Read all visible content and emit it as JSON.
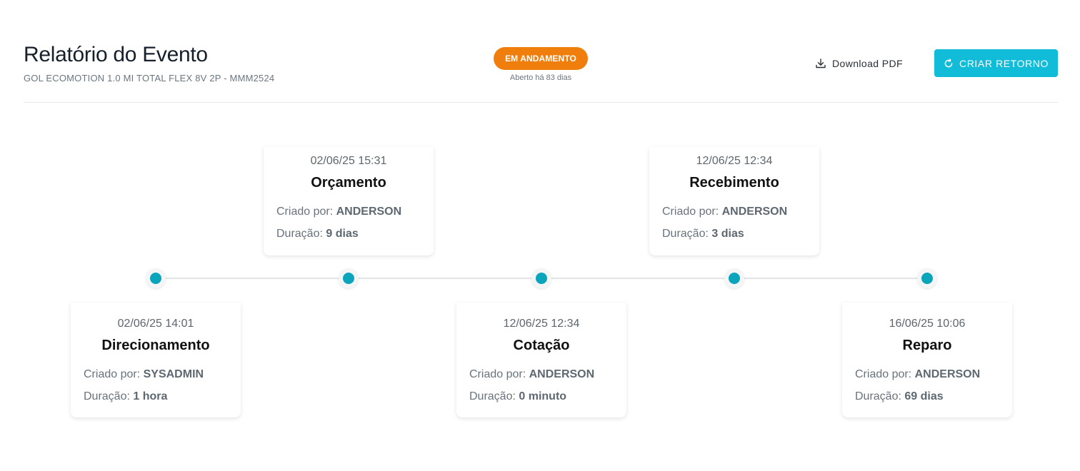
{
  "header": {
    "title": "Relatório do Evento",
    "subtitle": "GOL ECOMOTION 1.0 MI TOTAL FLEX 8V 2P - MMM2524",
    "status_badge": "EM ANDAMENTO",
    "status_sub": "Aberto há 83 dias",
    "download_label": "Download PDF",
    "retorno_label": "CRIAR RETORNO"
  },
  "colors": {
    "accent": "#10bcd8",
    "dot": "#0aa4bb",
    "status": "#f07e0c"
  },
  "labels": {
    "created_by": "Criado por:",
    "duration": "Duração:"
  },
  "timeline": [
    {
      "date": "02/06/25 14:01",
      "name": "Direcionamento",
      "created_by": "SYSADMIN",
      "duration": "1 hora"
    },
    {
      "date": "02/06/25 15:31",
      "name": "Orçamento",
      "created_by": "ANDERSON",
      "duration": "9 dias"
    },
    {
      "date": "12/06/25 12:34",
      "name": "Cotação",
      "created_by": "ANDERSON",
      "duration": "0 minuto"
    },
    {
      "date": "12/06/25 12:34",
      "name": "Recebimento",
      "created_by": "ANDERSON",
      "duration": "3 dias"
    },
    {
      "date": "16/06/25 10:06",
      "name": "Reparo",
      "created_by": "ANDERSON",
      "duration": "69 dias"
    }
  ]
}
